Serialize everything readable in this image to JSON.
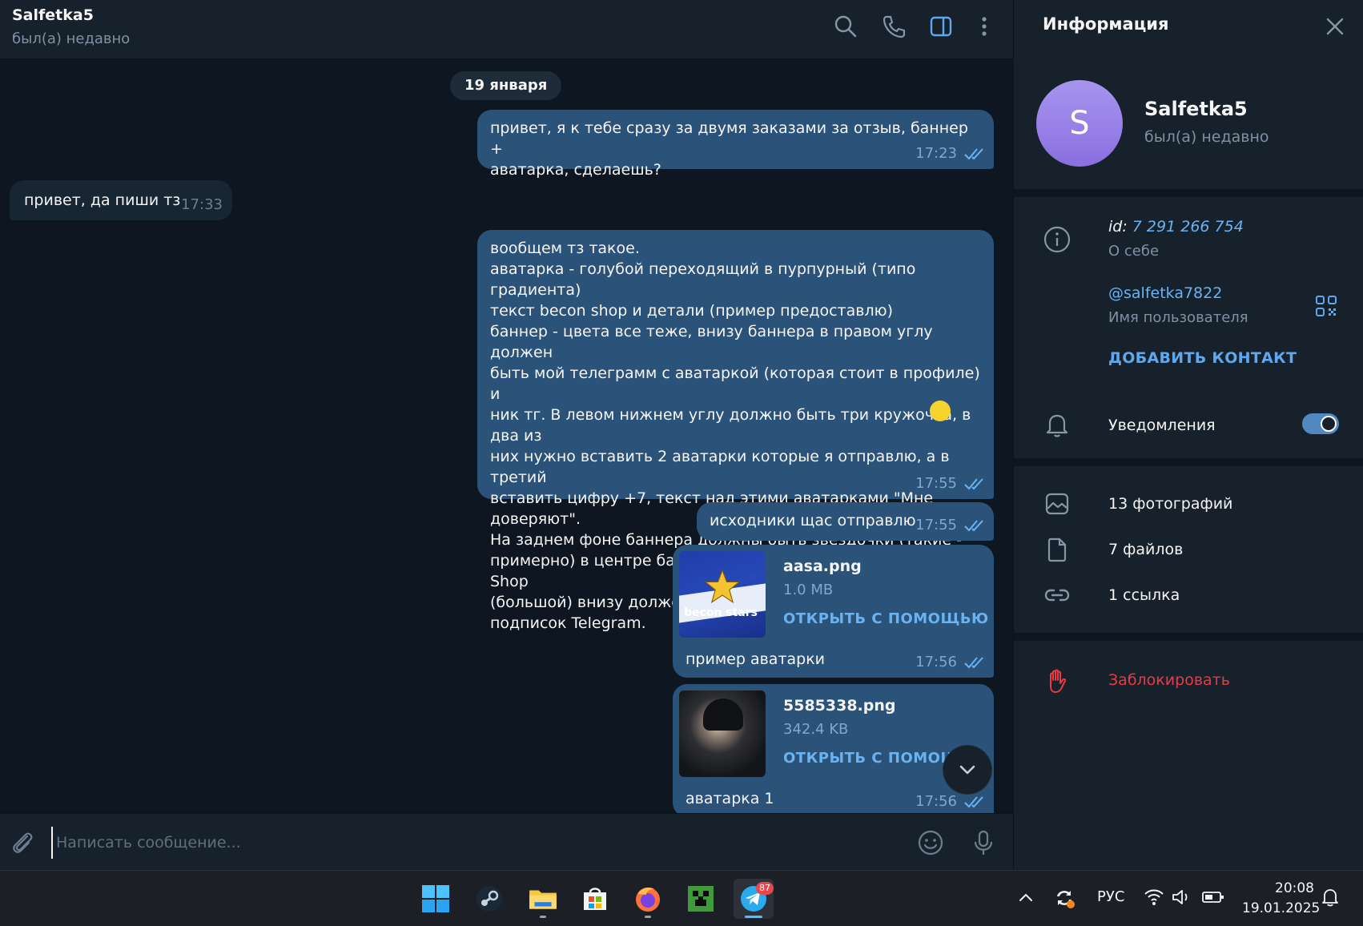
{
  "header": {
    "title": "Salfetka5",
    "status": "был(а) недавно"
  },
  "chat": {
    "date_separator": "19 января",
    "messages": [
      {
        "text": "привет, я к тебе сразу за двумя заказами за отзыв, баннер +\nаватарка, сделаешь?",
        "time": "17:23"
      },
      {
        "text": "привет, да пиши тз",
        "time": "17:33"
      },
      {
        "text": "вообщем тз такое.\nаватарка - голубой переходящий в пурпурный (типо градиента)\nтекст becon shop и детали (пример предоставлю)\nбаннер - цвета все теже, внизу баннера в правом углу должен\nбыть мой телеграмм с аватаркой (которая стоит в профиле) и\nник тг. В левом нижнем углу должно быть три кружочка, в два из\nних нужно вставить 2 аватарки которые я отправлю, а в третий\nвставить цифру +7, текст над этими аватарками \"Мне доверяют\".\nНа заднем фоне баннера должны быть звездочки (такие - \nпримерно) в центре баннера должен быть текст - Becon Shop\n(большой) внизу должен быть текст - магазин валюты и\nподписок Telegram.",
        "time": "17:55"
      },
      {
        "text": "исходники щас отправлю",
        "time": "17:55"
      }
    ],
    "files": [
      {
        "name": "aasa.png",
        "size": "1.0 MB",
        "open_label": "ОТКРЫТЬ С ПОМОЩЬЮ",
        "caption": "пример аватарки",
        "time": "17:56",
        "thumb_text": "becon stars"
      },
      {
        "name": "5585338.png",
        "size": "342.4 KB",
        "open_label": "ОТКРЫТЬ С ПОМОЩЬЮ",
        "caption": "аватарка 1",
        "time": "17:56"
      }
    ]
  },
  "composer": {
    "placeholder": "Написать сообщение..."
  },
  "sidebar": {
    "title": "Информация",
    "avatar_letter": "S",
    "name": "Salfetka5",
    "status": "был(а) недавно",
    "id_label": "id:",
    "id_value": "7 291 266 754",
    "about_label": "О себе",
    "username": "@salfetka7822",
    "username_label": "Имя пользователя",
    "add_contact": "ДОБАВИТЬ КОНТАКТ",
    "notifications": "Уведомления",
    "notifications_on": true,
    "photos": "13 фотографий",
    "files": "7 файлов",
    "links": "1 ссылка",
    "block": "Заблокировать"
  },
  "taskbar": {
    "lang": "РУС",
    "time": "20:08",
    "date": "19.01.2025",
    "telegram_badge": "87"
  },
  "colors": {
    "bg": "#0e1621",
    "panel": "#17212b",
    "bubble_out": "#2b5278",
    "bubble_in": "#182533",
    "accent": "#6ab3f3",
    "danger": "#ec3942"
  }
}
